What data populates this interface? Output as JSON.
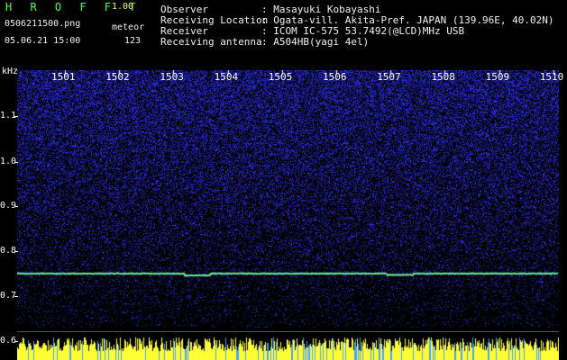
{
  "header": {
    "title": "H R O F F T",
    "version": "1.00",
    "filename": "0506211500.png",
    "mode": "meteor",
    "datetime": "05.06.21 15:00",
    "count": "123",
    "fields": [
      {
        "label": "Observer",
        "value": ": Masayuki Kobayashi"
      },
      {
        "label": "Receiving Location",
        "value": ": Ogata-vill. Akita-Pref. JAPAN (139.96E, 40.02N)"
      },
      {
        "label": "Receiver",
        "value": ": ICOM IC-575 53.7492(@LCD)MHz USB"
      },
      {
        "label": "Receiving antenna",
        "value": ": A504HB(yagi 4el)"
      }
    ]
  },
  "plot": {
    "y_unit": "kHz",
    "y_ticks": [
      "1.1",
      "1.0",
      "0.9",
      "0.8",
      "0.7",
      "0.6"
    ],
    "x_ticks": [
      "1501",
      "1502",
      "1503",
      "1504",
      "1505",
      "1506",
      "1507",
      "1508",
      "1509",
      "1510"
    ],
    "carrier_khz": 0.75,
    "colors": {
      "noise": "#2a2ad8",
      "carrier": "#40e0b0",
      "level": "#ffff33"
    }
  }
}
